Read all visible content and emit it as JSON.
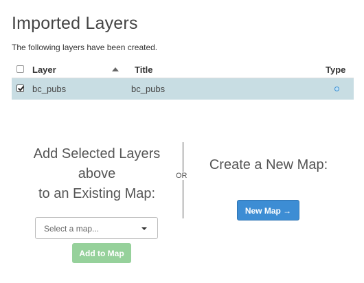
{
  "page": {
    "title": "Imported Layers",
    "subtitle": "The following layers have been created."
  },
  "table": {
    "columns": {
      "layer": "Layer",
      "title": "Title",
      "type": "Type"
    },
    "rows": [
      {
        "checked": true,
        "layer": "bc_pubs",
        "title": "bc_pubs",
        "type_icon": "vector-dot-icon"
      }
    ]
  },
  "add_section": {
    "heading_line1": "Add Selected Layers",
    "heading_line2": "above",
    "heading_line3": "to an Existing Map:",
    "select_placeholder": "Select a map...",
    "button_label": "Add to Map"
  },
  "or_label": "OR",
  "new_section": {
    "heading": "Create a New Map:",
    "button_label": "New Map →"
  },
  "colors": {
    "selected_row": "#c8dde3",
    "primary_button": "#3d8dd4",
    "disabled_button": "#96d19b"
  }
}
